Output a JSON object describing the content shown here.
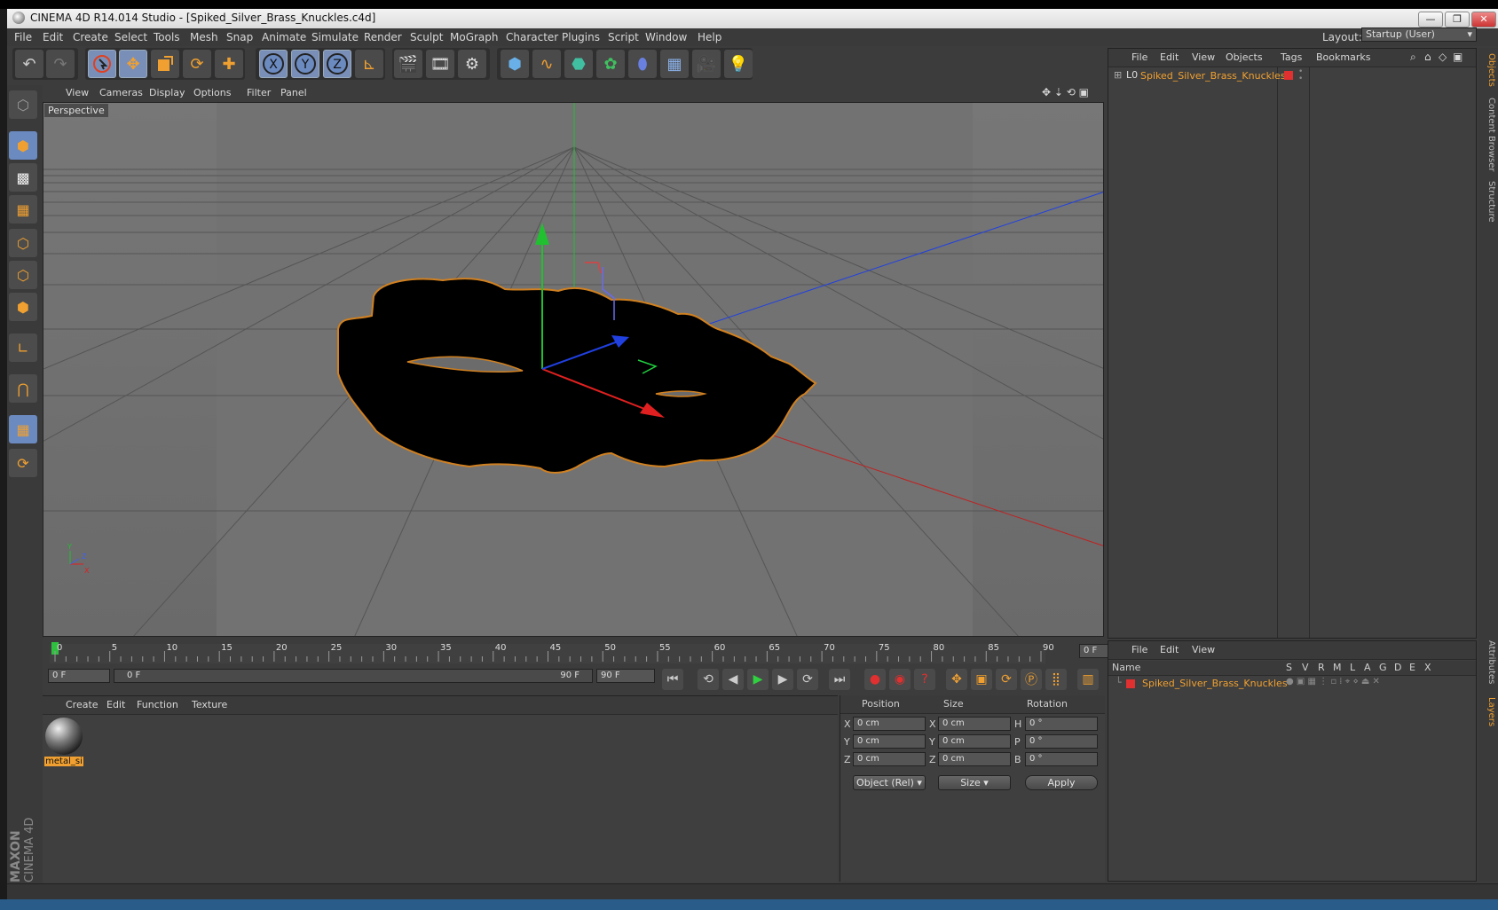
{
  "window": {
    "title": "CINEMA 4D R14.014 Studio - [Spiked_Silver_Brass_Knuckles.c4d]",
    "controls": [
      "—",
      "❐",
      "✕"
    ]
  },
  "menubar": {
    "items": [
      "File",
      "Edit",
      "Create",
      "Select",
      "Tools",
      "Mesh",
      "Snap",
      "Animate",
      "Simulate",
      "Render",
      "Sculpt",
      "MoGraph",
      "Character",
      "Plugins",
      "Script",
      "Window",
      "Help"
    ],
    "layout_label": "Layout:",
    "layout_value": "Startup (User)"
  },
  "toolbar": {
    "icons": [
      "undo-icon",
      "redo-icon",
      "live-selection-icon",
      "move-icon",
      "scale-icon",
      "rotate-icon",
      "add-icon",
      "x-axis-icon",
      "y-axis-icon",
      "z-axis-icon",
      "world-coordinates-icon",
      "render-view-icon",
      "render-picture-viewer-icon",
      "edit-render-settings-icon",
      "cube-icon",
      "spline-icon",
      "nurbs-icon",
      "array-icon",
      "deformer-icon",
      "floor-icon",
      "camera-icon",
      "light-icon"
    ],
    "axis_labels": [
      "X",
      "Y",
      "Z"
    ]
  },
  "left_toolbar": {
    "icons": [
      "make-editable-icon",
      "model-mode-icon",
      "texture-mode-icon",
      "workplane-icon",
      "points-mode-icon",
      "edges-mode-icon",
      "polygons-mode-icon",
      "axis-mode-icon",
      "tweak-icon",
      "snap-icon",
      "lock-workplane-icon"
    ]
  },
  "viewport": {
    "menu": [
      "View",
      "Cameras",
      "Display",
      "Options",
      "Filter",
      "Panel"
    ],
    "label": "Perspective",
    "axis_labels": [
      "Y",
      "X",
      "Z"
    ]
  },
  "timeline": {
    "ticks": [
      "0",
      "5",
      "10",
      "15",
      "20",
      "25",
      "30",
      "35",
      "40",
      "45",
      "50",
      "55",
      "60",
      "65",
      "70",
      "75",
      "80",
      "85",
      "90"
    ],
    "current_frame_field": "0 F",
    "start_field": "0 F",
    "range_start": "0 F",
    "range_end": "90 F",
    "end_field": "90 F"
  },
  "material_panel": {
    "menu": [
      "Create",
      "Edit",
      "Function",
      "Texture"
    ],
    "materials": [
      {
        "name": "metal_si"
      }
    ]
  },
  "coordinates": {
    "headers": [
      "Position",
      "Size",
      "Rotation"
    ],
    "rows": [
      {
        "pos_axis": "X",
        "pos": "0 cm",
        "size_axis": "X",
        "size": "0 cm",
        "rot_axis": "H",
        "rot": "0 °"
      },
      {
        "pos_axis": "Y",
        "pos": "0 cm",
        "size_axis": "Y",
        "size": "0 cm",
        "rot_axis": "P",
        "rot": "0 °"
      },
      {
        "pos_axis": "Z",
        "pos": "0 cm",
        "size_axis": "Z",
        "size": "0 cm",
        "rot_axis": "B",
        "rot": "0 °"
      }
    ],
    "mode_select": "Object (Rel)",
    "size_select": "Size",
    "apply_label": "Apply"
  },
  "object_manager": {
    "menu": [
      "File",
      "Edit",
      "View",
      "Objects",
      "Tags",
      "Bookmarks"
    ],
    "objects": [
      {
        "name": "Spiked_Silver_Brass_Knuckles",
        "layer_color": "#e03030"
      }
    ]
  },
  "layer_manager": {
    "menu": [
      "File",
      "Edit",
      "View"
    ],
    "columns": [
      "Name",
      "S",
      "V",
      "R",
      "M",
      "L",
      "A",
      "G",
      "D",
      "E",
      "X"
    ],
    "layers": [
      {
        "name": "Spiked_Silver_Brass_Knuckles",
        "color": "#e03030"
      }
    ]
  },
  "side_tabs": [
    "Objects",
    "Content Browser",
    "Structure",
    "Attributes",
    "Layers"
  ],
  "branding": {
    "line1": "MAXON",
    "line2": "CINEMA 4D"
  },
  "colors": {
    "accent": "#f0a030",
    "selection": "#6b8ac0",
    "y_axis": "#20c030",
    "x_axis": "#e02020",
    "z_axis": "#2040e0"
  }
}
